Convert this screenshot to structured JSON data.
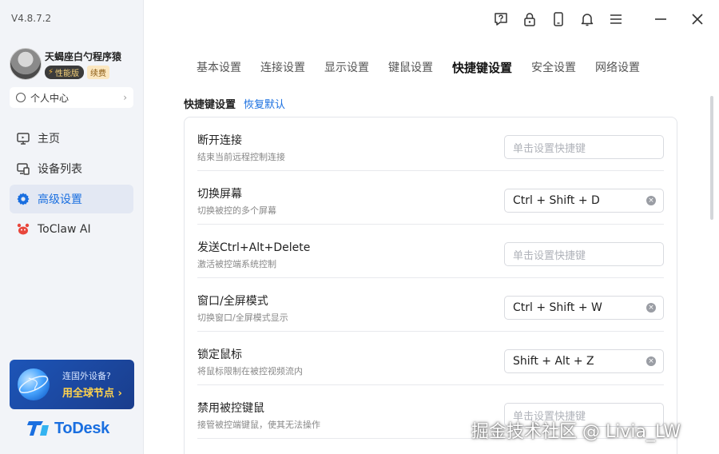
{
  "app": {
    "version": "V4.8.7.2"
  },
  "user": {
    "name": "天蝎座白勺程序猿",
    "badge_perf": "性能版",
    "badge_renew": "续费",
    "personal_center": "个人中心"
  },
  "nav": [
    {
      "label": "主页",
      "icon": "monitor-icon"
    },
    {
      "label": "设备列表",
      "icon": "devices-icon"
    },
    {
      "label": "高级设置",
      "icon": "gear-icon",
      "active": true
    },
    {
      "label": "ToClaw AI",
      "icon": "crab-icon"
    }
  ],
  "promo": {
    "question": "连国外设备?",
    "cta": "用全球节点 ›"
  },
  "brand": {
    "logo_text": "ToDesk",
    "accent": "#1a6fe0"
  },
  "top_icons": [
    "help-icon",
    "lock-icon",
    "phone-icon",
    "bell-icon",
    "menu-icon",
    "minimize-icon",
    "close-icon"
  ],
  "tabs": [
    "基本设置",
    "连接设置",
    "显示设置",
    "键鼠设置",
    "快捷键设置",
    "安全设置",
    "网络设置"
  ],
  "active_tab": "快捷键设置",
  "section": {
    "title": "快捷键设置",
    "restore": "恢复默认"
  },
  "shortcuts": [
    {
      "title": "断开连接",
      "desc": "结束当前远程控制连接",
      "value": "",
      "placeholder": "单击设置快捷键"
    },
    {
      "title": "切换屏幕",
      "desc": "切换被控的多个屏幕",
      "value": "Ctrl + Shift + D",
      "placeholder": ""
    },
    {
      "title": "发送Ctrl+Alt+Delete",
      "desc": "激活被控端系统控制",
      "value": "",
      "placeholder": "单击设置快捷键"
    },
    {
      "title": "窗口/全屏模式",
      "desc": "切换窗口/全屏模式显示",
      "value": "Ctrl + Shift + W",
      "placeholder": ""
    },
    {
      "title": "锁定鼠标",
      "desc": "将鼠标限制在被控视频流内",
      "value": "Shift + Alt + Z",
      "placeholder": ""
    },
    {
      "title": "禁用被控键鼠",
      "desc": "接管被控端键鼠，使其无法操作",
      "value": "",
      "placeholder": "单击设置快捷键"
    }
  ],
  "watermark": "掘金技术社区 @ Livia_LW"
}
